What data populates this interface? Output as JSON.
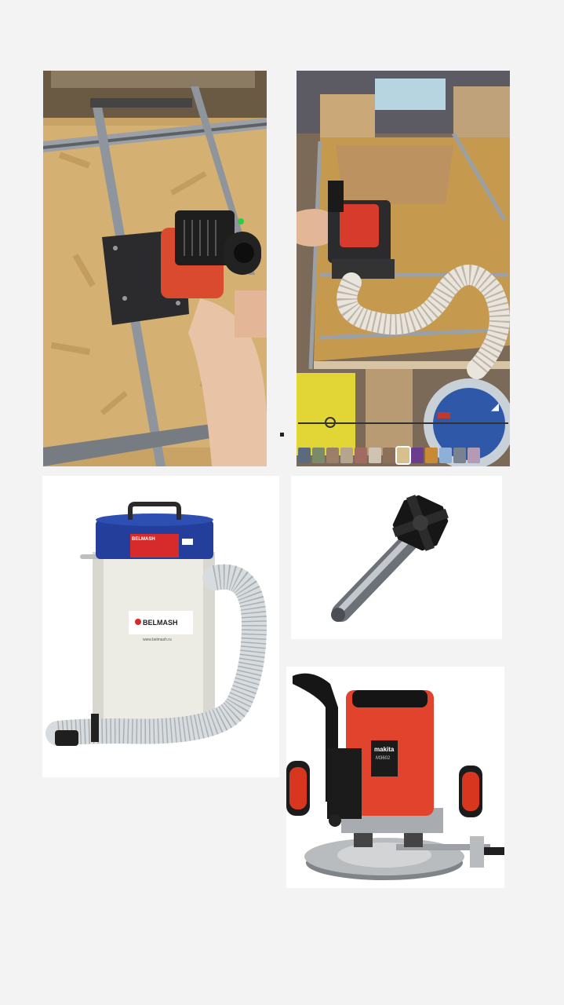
{
  "collage": {
    "video_thumbnail_count": 13,
    "video_progress": 0.15
  },
  "dust_collector": {
    "brand_lid": "BELMASH",
    "brand_body": "BELMASH",
    "site": "www.belmash.ru"
  },
  "router": {
    "brand": "makita",
    "model": "M3602"
  },
  "icons": {
    "mute": "speaker-muted-icon"
  }
}
